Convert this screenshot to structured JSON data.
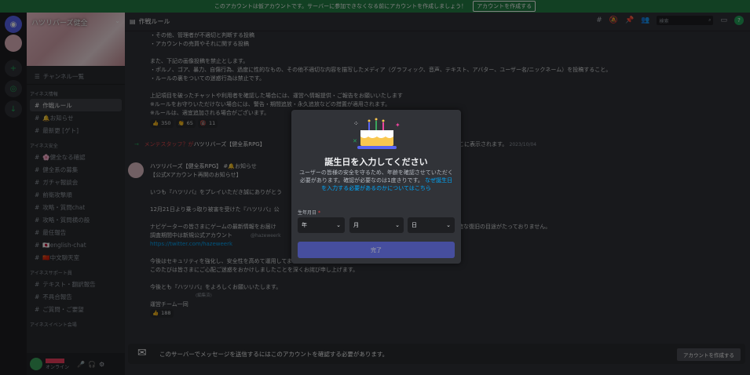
{
  "banner": {
    "text": "このアカウントは仮アカウントです。サーバーに参加できなくなる前にアカウントを作成しましょう！",
    "button": "アカウントを作成する"
  },
  "server": {
    "name": "ハツリバーズ健全"
  },
  "sidebar": {
    "channel_list": "チャンネル一覧",
    "categories": [
      {
        "label": "アイネス情報",
        "items": [
          {
            "label": "作戦ルール",
            "active": true
          },
          {
            "label": "🔔お知らせ",
            "active": false
          },
          {
            "label": "最新更 [ゲト]",
            "active": false
          }
        ]
      },
      {
        "label": "アイネス安全",
        "items": [
          {
            "label": "🌸健全なる確認",
            "active": false
          },
          {
            "label": "健全系の募集",
            "active": false
          },
          {
            "label": "ガチャ報談会",
            "active": false
          },
          {
            "label": "前衛攻撃順",
            "active": false
          },
          {
            "label": "攻略・質問chat",
            "active": false
          },
          {
            "label": "攻略・質問横の般",
            "active": false
          },
          {
            "label": "最任報告",
            "active": false
          },
          {
            "label": "🇯🇵english-chat",
            "active": false
          },
          {
            "label": "🇨🇳中文聊天室",
            "active": false
          }
        ]
      },
      {
        "label": "アイネスサポート員",
        "items": [
          {
            "label": "テキスト・翻訳報告",
            "active": false
          },
          {
            "label": "不具合報告",
            "active": false
          },
          {
            "label": "ご質問・ご要望",
            "active": false
          }
        ]
      },
      {
        "label": "アイネスイベント会場",
        "items": []
      }
    ],
    "user_status": "オンライン"
  },
  "topbar": {
    "channel": "作戦ルール",
    "search_placeholder": "検索"
  },
  "messages": {
    "rules_lines": [
      "・その他、管理者が不適切と判断する投稿",
      "・アカウントの売買やそれに関する投稿",
      "",
      "また、下記の画像投稿を禁止とします。",
      "・ポルノ、ゴア、暴力、自傷行為、過度に性的なもの、その他不適切な内容を描写したメディア（グラフィック、音声、テキスト、アバター、ユーザー名/ニックネーム）を投稿すること。",
      "・ルールの裏をついての迷惑行為は禁止です。",
      "",
      "上記項目を破ったチャットや利用者を確認した場合には、運営へ情報提供・ご報告をお願いいたします",
      "※ルールをお守りいただけない場合には、警告・期間追放・永久追放などの措置が適用されます。",
      "※ルールは、適宜追加される場合がございます。"
    ],
    "reactions1": [
      {
        "emoji": "👍",
        "count": "350"
      },
      {
        "emoji": "👏",
        "count": "65"
      },
      {
        "emoji": "🔞",
        "count": "11"
      }
    ],
    "system_prefix": "メンテスタッフ？が",
    "system_channel": "ハツリバーズ【健全系RPG】",
    "system_suffix": "がここに表示されます。",
    "system_time": "2023/10/04",
    "author": "ハツリバーズ【健全系RPG】",
    "author_tag": "#🔔お知らせ",
    "announce_lines": [
      "【公式Xアカウント再開のお知らせ】",
      "",
      "いつも『ハツリバ』をプレイいただき誠にありがとう",
      "",
      "12月21日より乗っ取り被害を受けた『ハツリバ』公",
      "",
      "ナビゲーターの皆さまにゲームの最新情報をお届け",
      "調査期間中は新規公式アカウント"
    ],
    "right_fragment": "で明確な復旧の目途がたっておりません。",
    "handle": "@hazeweerk",
    "link": "https://twitter.com/hazeweerk",
    "closing_lines": [
      "今後はセキュリティを強化し、安全性を高めて運用してまいります。",
      "このたびは皆さまにご心配ご迷惑をおかけしましたことを深くお詫び申し上げます。",
      "",
      "今後とも『ハツリバ』をよろしくお願いいたします。",
      "",
      "運営チーム一同"
    ],
    "edited": "(編集済)",
    "reactions2": [
      {
        "emoji": "👍",
        "count": "188"
      }
    ]
  },
  "bottombar": {
    "text": "このサーバーでメッセージを送信するにはこのアカウントを確認する必要があります。",
    "button": "アカウントを作成する"
  },
  "modal": {
    "title": "誕生日を入力してください",
    "desc": "ユーザーの皆様の安全を守るため、年齢を確認させていただく必要があります。確認が必要なのは1度きりです。",
    "link": "なぜ誕生日を入力する必要があるのかについてはこちら",
    "field_label": "生年月日",
    "required": "*",
    "year": "年",
    "month": "月",
    "day": "日",
    "done": "完了"
  }
}
